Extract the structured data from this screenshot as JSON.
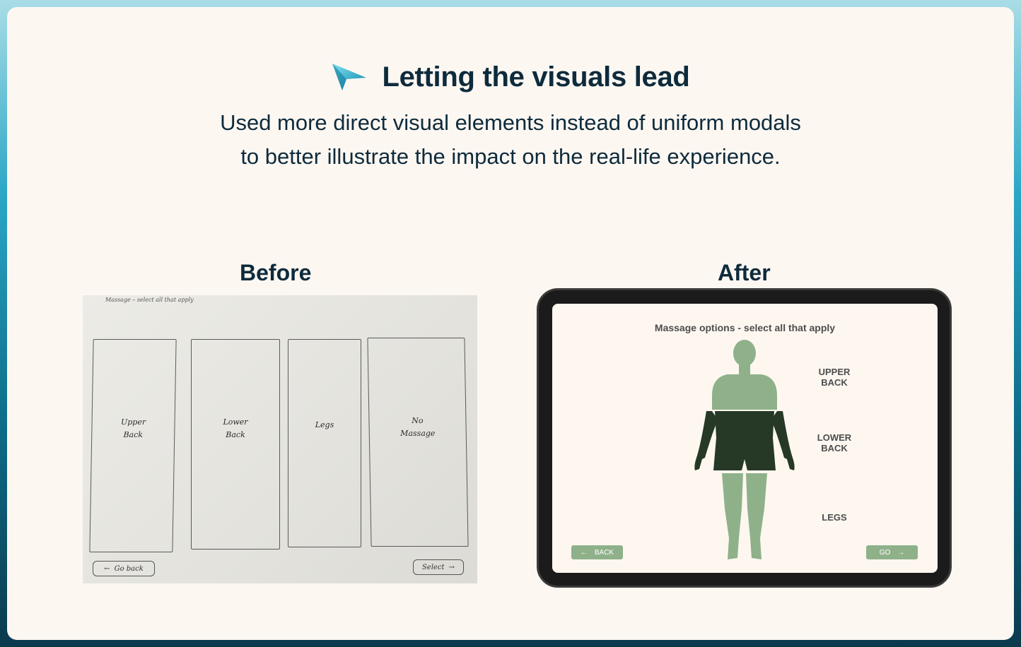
{
  "header": {
    "title": "Letting the visuals lead",
    "subtitle_line1": "Used more direct visual elements instead of uniform modals",
    "subtitle_line2": "to better illustrate the impact on the real-life experience."
  },
  "before": {
    "title": "Before",
    "header_text": "Massage – select all that apply",
    "panels": [
      {
        "label_line1": "Upper",
        "label_line2": "Back"
      },
      {
        "label_line1": "Lower",
        "label_line2": "Back"
      },
      {
        "label_line1": "Legs",
        "label_line2": ""
      },
      {
        "label_line1": "No",
        "label_line2": "Massage"
      }
    ],
    "back_label": "Go back",
    "select_label": "Select"
  },
  "after": {
    "title": "After",
    "screen_title": "Massage options - select all that apply",
    "upper_back_line1": "UPPER",
    "upper_back_line2": "BACK",
    "lower_back_line1": "LOWER",
    "lower_back_line2": "BACK",
    "legs_label": "LEGS",
    "back_label": "BACK",
    "go_label": "GO"
  },
  "colors": {
    "accent_blue": "#2aa7c6",
    "navy": "#0e2b3c",
    "upper_green": "#8fb18a",
    "dark_green": "#263826",
    "leg_green": "#8fb18a"
  }
}
